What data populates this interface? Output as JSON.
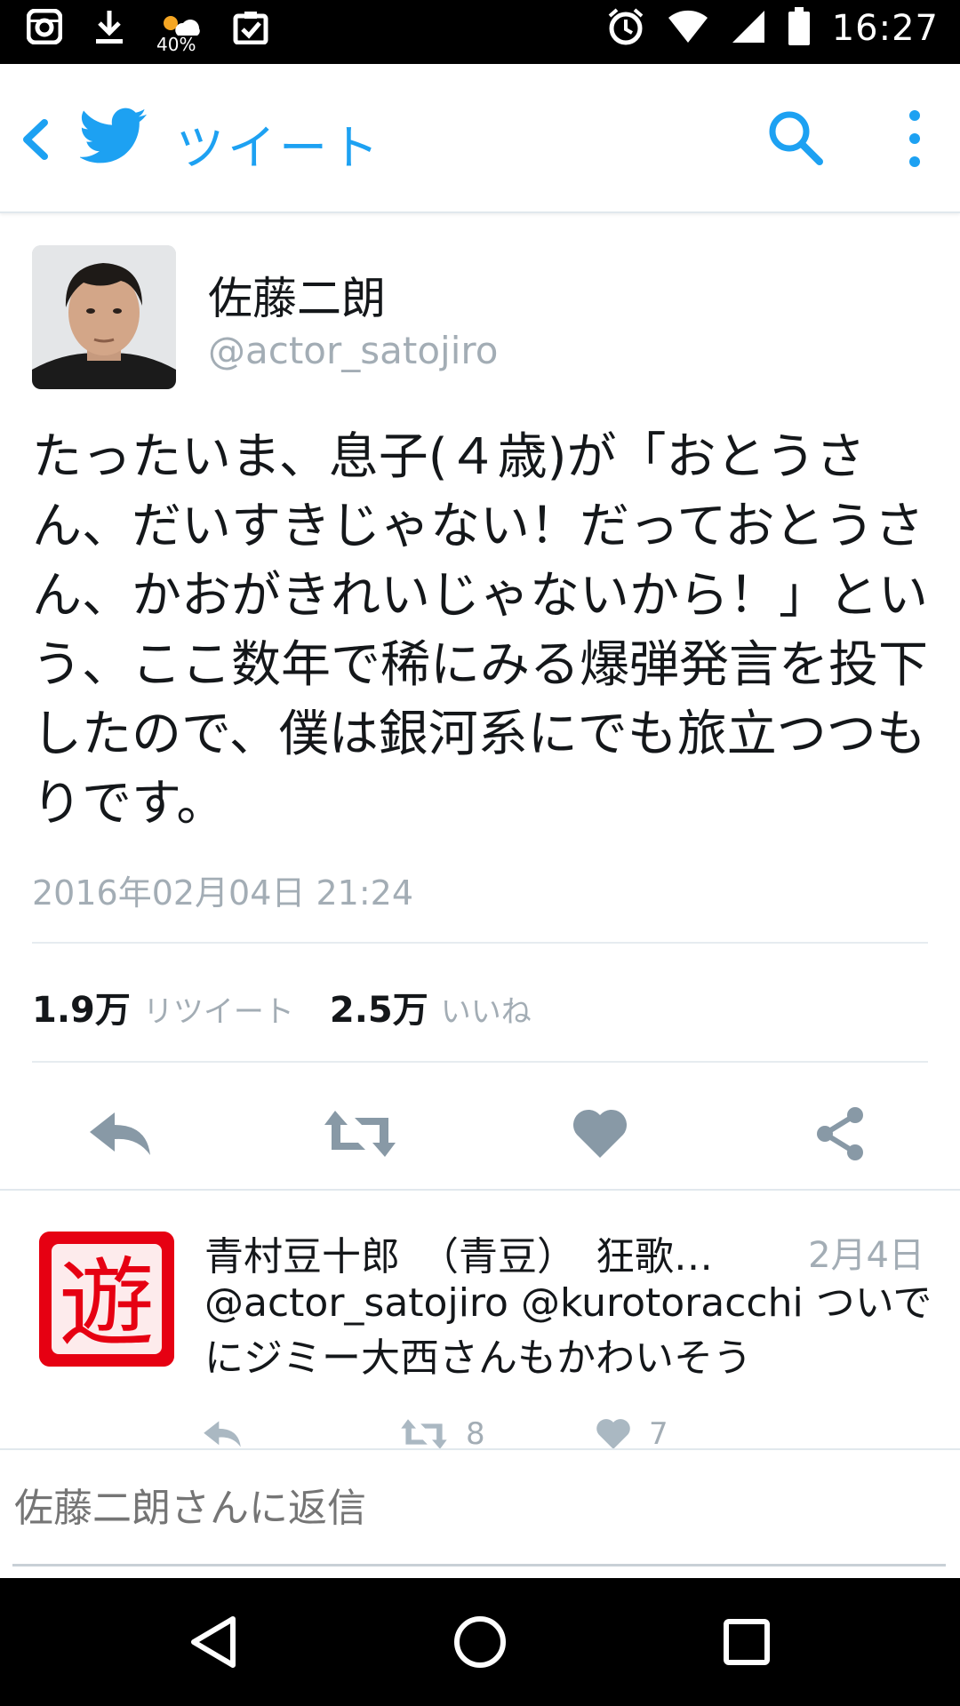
{
  "status_bar": {
    "time": "16:27",
    "weather_percent": "40%",
    "icons": [
      "instagram-icon",
      "download-icon",
      "weather-icon",
      "clipboard-check-icon",
      "alarm-icon",
      "wifi-icon",
      "signal-icon",
      "battery-icon"
    ]
  },
  "header": {
    "title": "ツイート",
    "accent_color": "#1da1f2",
    "icons": [
      "back-icon",
      "twitter-bird-icon",
      "search-icon",
      "more-vert-icon"
    ]
  },
  "tweet": {
    "author_name": "佐藤二朗",
    "author_handle": "@actor_satojiro",
    "text": "たったいま、息子(４歳)が「おとうさん、だいすきじゃない！だっておとうさん、かおがきれいじゃないから！」という、ここ数年で稀にみる爆弾発言を投下したので、僕は銀河系にでも旅立つつもりです。",
    "timestamp": "2016年02月04日 21:24",
    "retweets_count": "1.9万",
    "retweets_label": "リツイート",
    "likes_count": "2.5万",
    "likes_label": "いいね",
    "actions": [
      "reply-icon",
      "retweet-icon",
      "like-icon",
      "share-icon"
    ]
  },
  "reply": {
    "author_name": "青村豆十郎　（青豆）　狂歌…",
    "date": "2月4日",
    "text": "@actor_satojiro @kurotoracchi ついでにジミー大西さんもかわいそう",
    "avatar_glyph": "遊",
    "retweet_count": "8",
    "like_count": "7"
  },
  "composer": {
    "placeholder": "佐藤二朗さんに返信"
  },
  "nav": [
    "back-triangle-icon",
    "home-circle-icon",
    "recents-square-icon"
  ]
}
